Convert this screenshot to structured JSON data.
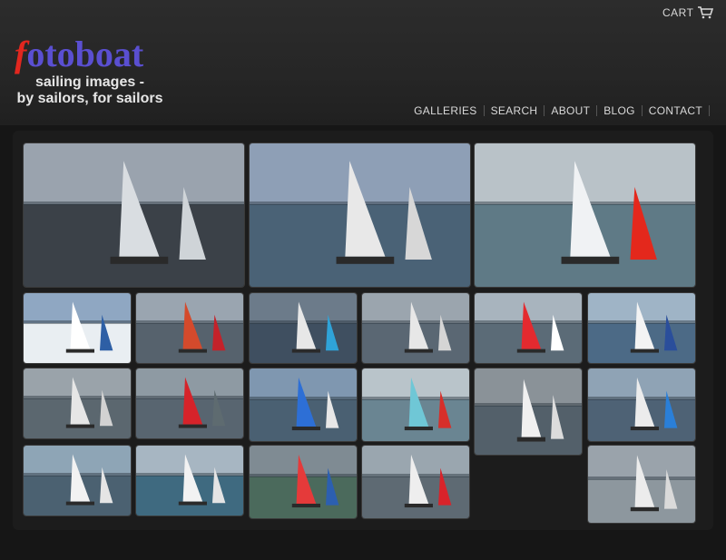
{
  "logo": {
    "first_letter": "f",
    "rest": "otoboat"
  },
  "tagline": {
    "line1": "sailing images -",
    "line2": "by sailors, for sailors"
  },
  "cart": {
    "label": "CART",
    "icon": "cart-icon"
  },
  "nav": {
    "items": [
      "GALLERIES",
      "SEARCH",
      "ABOUT",
      "BLOG",
      "CONTACT"
    ]
  },
  "colors": {
    "logo_f": "#e2271f",
    "logo_text": "#5a4fd1",
    "background": "#161616"
  },
  "thumbnails": [
    {
      "id": "t1",
      "sky": "#9aa3ae",
      "sea": "#3b4148",
      "sail": "#d9dde1",
      "sail2": "#cfd4d8"
    },
    {
      "id": "t2",
      "sky": "#8e9fb6",
      "sea": "#4a6276",
      "sail": "#e8e8e8",
      "sail2": "#d7d7d7"
    },
    {
      "id": "t3",
      "sky": "#b9c2c8",
      "sea": "#5f7a86",
      "sail": "#f0f2f4",
      "sail2": "#e4281c"
    },
    {
      "id": "t4",
      "sky": "#8fa7c2",
      "sea": "#e9eef2",
      "sail": "#ffffff",
      "sail2": "#2e5fa5"
    },
    {
      "id": "t5",
      "sky": "#9aa5b0",
      "sea": "#56626d",
      "sail": "#d44a2c",
      "sail2": "#c4222a"
    },
    {
      "id": "t6",
      "sky": "#6c7b8a",
      "sea": "#3f4f60",
      "sail": "#e7e7e7",
      "sail2": "#2fa3d8"
    },
    {
      "id": "t7",
      "sky": "#9ba5ae",
      "sea": "#5a6773",
      "sail": "#e7e7e7",
      "sail2": "#d5d5d5"
    },
    {
      "id": "t8",
      "sky": "#a8b4be",
      "sea": "#5b6b77",
      "sail": "#e42a2f",
      "sail2": "#ffffff"
    },
    {
      "id": "t9",
      "sky": "#9fb4c6",
      "sea": "#4c6a86",
      "sail": "#f3f3f3",
      "sail2": "#2a4e9b"
    },
    {
      "id": "t10",
      "sky": "#9aa3aa",
      "sea": "#5b676f",
      "sail": "#e6e6e6",
      "sail2": "#d2d2d2"
    },
    {
      "id": "t11",
      "sky": "#8e9aa3",
      "sea": "#586570",
      "sail": "#d6232a",
      "sail2": "#5e6b70"
    },
    {
      "id": "t12",
      "sky": "#7f97b0",
      "sea": "#4a6072",
      "sail": "#2d6fd6",
      "sail2": "#e7e7e7"
    },
    {
      "id": "t13",
      "sky": "#b9c4ca",
      "sea": "#6a8592",
      "sail": "#6fc7d6",
      "sail2": "#d72f2a"
    },
    {
      "id": "t14",
      "sky": "#8a9298",
      "sea": "#53606a",
      "sail": "#f0f0f0",
      "sail2": "#dcdcdc"
    },
    {
      "id": "t15",
      "sky": "#8fa3b5",
      "sea": "#4e6275",
      "sail": "#ececec",
      "sail2": "#2a7fd8"
    },
    {
      "id": "t16",
      "sky": "#8ea5b6",
      "sea": "#4b6171",
      "sail": "#f2f2f2",
      "sail2": "#e5e5e5"
    },
    {
      "id": "t17",
      "sky": "#a7b6c2",
      "sea": "#3f6a80",
      "sail": "#f2f2f2",
      "sail2": "#e4e4e4"
    },
    {
      "id": "t18",
      "sky": "#7f8b93",
      "sea": "#4b6a5c",
      "sail": "#e53a3a",
      "sail2": "#2c5fb0"
    },
    {
      "id": "t19",
      "sky": "#9aa6af",
      "sea": "#5e6a73",
      "sail": "#eeeeee",
      "sail2": "#d8232a"
    },
    {
      "id": "t20",
      "sky": "#9aa3ab",
      "sea": "#8d979e",
      "sail": "#ececec",
      "sail2": "#dadada"
    }
  ]
}
